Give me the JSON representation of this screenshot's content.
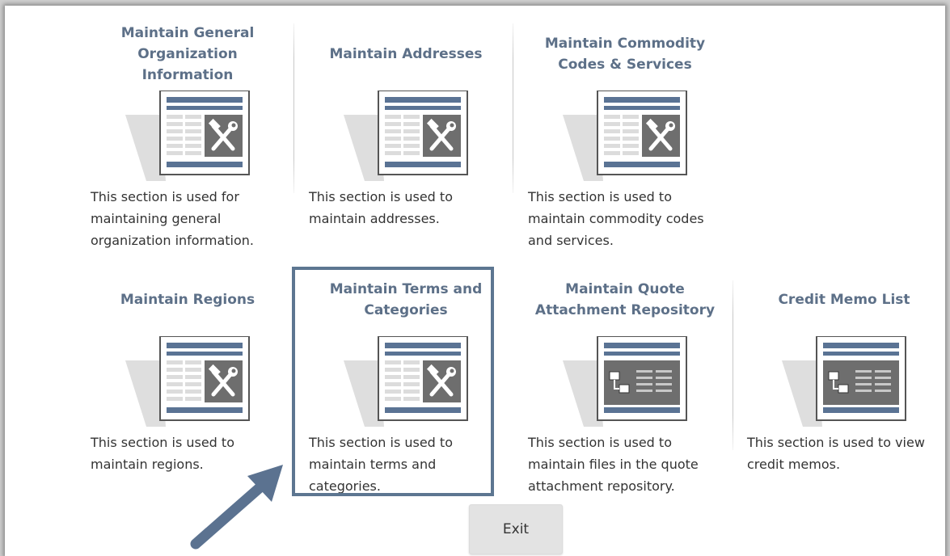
{
  "tiles": [
    {
      "title": "Maintain General Organization Information",
      "description": "This section is used for maintaining general organization information.",
      "icon": "wrench-hammer-icon"
    },
    {
      "title": "Maintain Addresses",
      "description": "This section is used to maintain addresses.",
      "icon": "wrench-hammer-icon"
    },
    {
      "title": "Maintain Commodity Codes & Services",
      "description": "This section is used to maintain commodity codes and services.",
      "icon": "wrench-hammer-icon"
    },
    {
      "title": "Maintain Regions",
      "description": "This section is used to maintain regions.",
      "icon": "wrench-hammer-icon"
    },
    {
      "title": "Maintain Terms and Categories",
      "description": "This section is used to maintain terms and categories.",
      "icon": "wrench-hammer-icon",
      "highlighted": true
    },
    {
      "title": "Maintain Quote Attachment Repository",
      "description": "This section is used to maintain files in the quote attachment repository.",
      "icon": "hierarchy-list-icon"
    },
    {
      "title": "Credit Memo List",
      "description": "This section is used to view credit memos.",
      "icon": "hierarchy-list-icon"
    }
  ],
  "exit_label": "Exit",
  "colors": {
    "title": "#5d7088",
    "highlight": "#5d7691",
    "icon_bar": "#5a7394",
    "arrow": "#5b7290"
  }
}
